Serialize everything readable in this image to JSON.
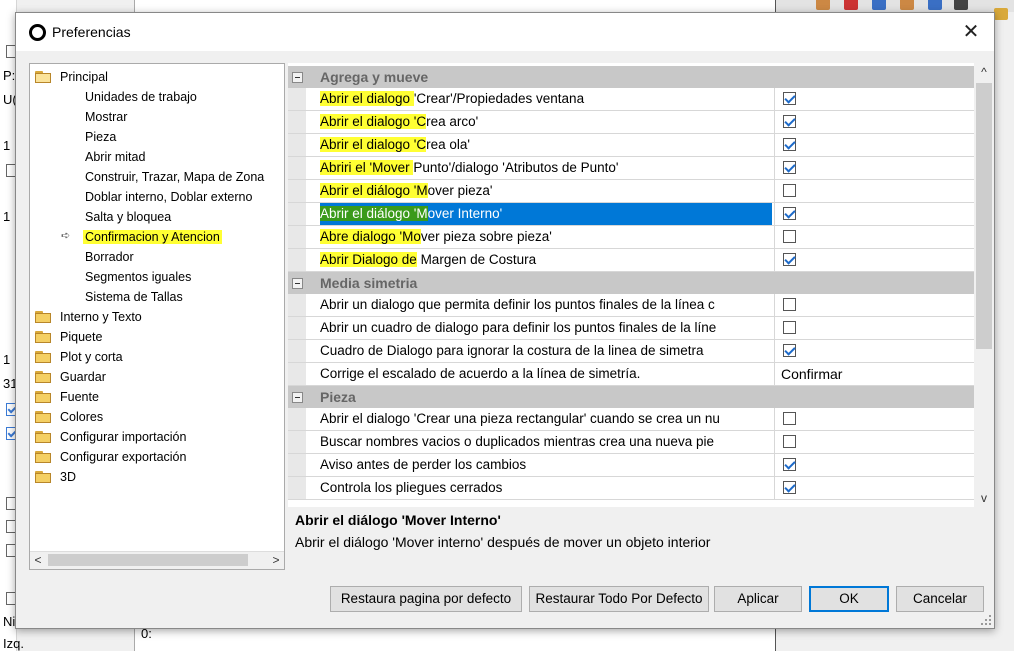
{
  "background": {
    "left_fragments": [
      "P:",
      "U(",
      "1",
      "1",
      "1",
      "31",
      "Ninguno",
      "Izq."
    ],
    "bottom_fragment": "0:"
  },
  "dialog": {
    "title": "Preferencias",
    "close_glyph": "✕",
    "tree": {
      "root": "Principal",
      "children": [
        "Unidades de trabajo",
        "Mostrar",
        "Pieza",
        "Abrir mitad",
        "Construir, Trazar, Mapa de Zona",
        "Doblar interno, Doblar externo",
        "Salta y bloquea",
        "Confirmacion y Atencion",
        "Borrador",
        "Segmentos iguales",
        "Sistema de Tallas"
      ],
      "selected_child_index": 7,
      "folders": [
        "Interno y Texto",
        "Piquete",
        "Plot y corta",
        "Guardar",
        "Fuente",
        "Colores",
        "Configurar importación",
        "Configurar exportación",
        "3D"
      ],
      "scroll_left": "<",
      "scroll_right": ">"
    },
    "grid": {
      "categories": [
        {
          "label": "Agrega y mueve",
          "rows": [
            {
              "hl": "Abrir el dialogo ",
              "rest": "'Crear'/Propiedades ventana",
              "checked": true
            },
            {
              "hl": "Abrir el dialogo 'C",
              "rest": "rea arco'",
              "checked": true
            },
            {
              "hl": "Abrir el dialogo 'C",
              "rest": "rea ola'",
              "checked": true
            },
            {
              "hl": "Abriri el  'Mover ",
              "rest": "Punto'/dialogo 'Atributos de Punto'",
              "checked": true
            },
            {
              "hl": "Abrir el diálogo 'M",
              "rest": "over pieza'",
              "checked": false
            },
            {
              "hl": "Abrir el diálogo 'M",
              "rest": "over Interno'",
              "checked": true,
              "selected": true
            },
            {
              "hl": "Abre dialogo 'Mo",
              "rest": "ver pieza sobre pieza'",
              "checked": false
            },
            {
              "hl": "Abrir Dialogo de",
              "rest": " Margen de Costura",
              "checked": true
            }
          ]
        },
        {
          "label": "Media simetria",
          "rows": [
            {
              "hl": "",
              "rest": "Abrir un dialogo que permita definir los puntos finales de la línea c",
              "checked": false
            },
            {
              "hl": "",
              "rest": "Abrir un cuadro de  dialogo para definir los puntos finales de la líne",
              "checked": false
            },
            {
              "hl": "",
              "rest": "Cuadro de Dialogo para ignorar la costura de la linea de simetra",
              "checked": true
            },
            {
              "hl": "",
              "rest": "Corrige el escalado  de acuerdo a la  línea de simetría.",
              "value_text": "Confirmar"
            }
          ]
        },
        {
          "label": "Pieza",
          "rows": [
            {
              "hl": "",
              "rest": "Abrir el dialogo  'Crear una pieza rectangular' cuando se crea un nu",
              "checked": false
            },
            {
              "hl": "",
              "rest": "Buscar nombres vacios o duplicados mientras crea una nueva pie",
              "checked": false
            },
            {
              "hl": "",
              "rest": "Aviso antes de perder los cambios",
              "checked": true
            },
            {
              "hl": "",
              "rest": "Controla los pliegues cerrados",
              "checked": true
            }
          ]
        }
      ],
      "scroll_up": "^",
      "scroll_down": "v"
    },
    "description": {
      "title": "Abrir el diálogo 'Mover Interno'",
      "text": "Abrir el diálogo 'Mover interno' después de mover un objeto interior"
    },
    "buttons": {
      "restore_page": "Restaura pagina por defecto",
      "restore_all": "Restaurar Todo Por Defecto",
      "apply": "Aplicar",
      "ok": "OK",
      "cancel": "Cancelar"
    },
    "colors": {
      "highlight": "#ffff33",
      "selection": "#0078d7",
      "category_bg": "#c8c8c8"
    }
  }
}
